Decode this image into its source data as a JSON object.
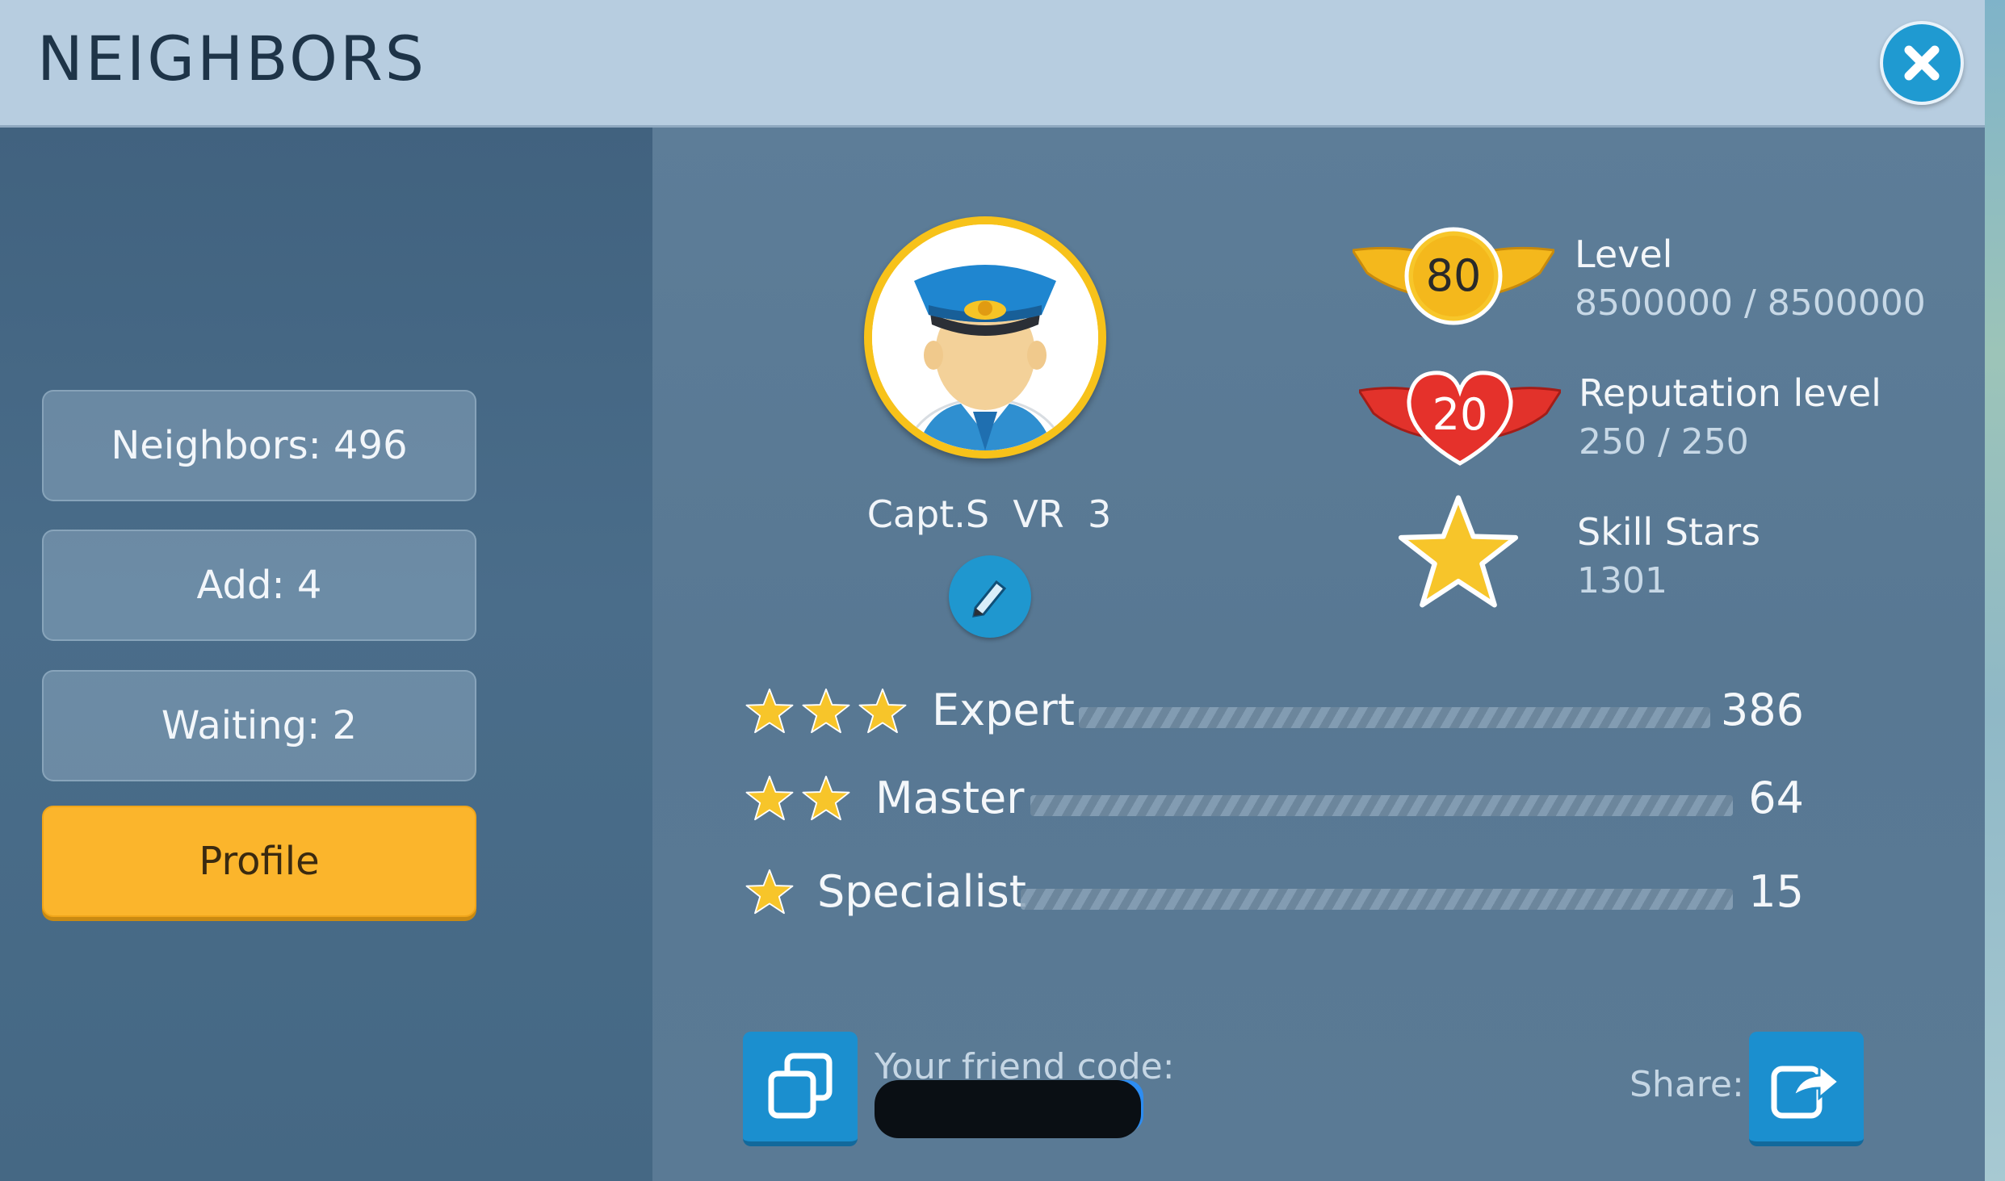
{
  "dialog": {
    "title": "NEIGHBORS"
  },
  "sidebar": {
    "items": [
      {
        "label": "Neighbors: 496"
      },
      {
        "label": "Add: 4"
      },
      {
        "label": "Waiting: 2"
      },
      {
        "label": "Profile",
        "active": true
      }
    ]
  },
  "profile": {
    "name": "Capt.S  VR  3",
    "level": {
      "label": "Level",
      "badge": "80",
      "value": "8500000 / 8500000"
    },
    "reputation": {
      "label": "Reputation level",
      "badge": "20",
      "value": "250 / 250"
    },
    "skill_stars": {
      "label": "Skill Stars",
      "value": "1301"
    }
  },
  "skills": [
    {
      "label": "Expert",
      "stars": 3,
      "count": "386"
    },
    {
      "label": "Master",
      "stars": 2,
      "count": "64"
    },
    {
      "label": "Specialist",
      "stars": 1,
      "count": "15"
    }
  ],
  "friend": {
    "label": "Your friend code:",
    "share_label": "Share:"
  },
  "colors": {
    "accent": "#fbb52c",
    "button_blue": "#1f97cf",
    "title_bar": "#b7cde0"
  },
  "icons": [
    "close-icon",
    "pilot-avatar",
    "pencil-icon",
    "level-wings-badge",
    "reputation-heart-badge",
    "star-icon",
    "copy-icon",
    "share-icon"
  ]
}
